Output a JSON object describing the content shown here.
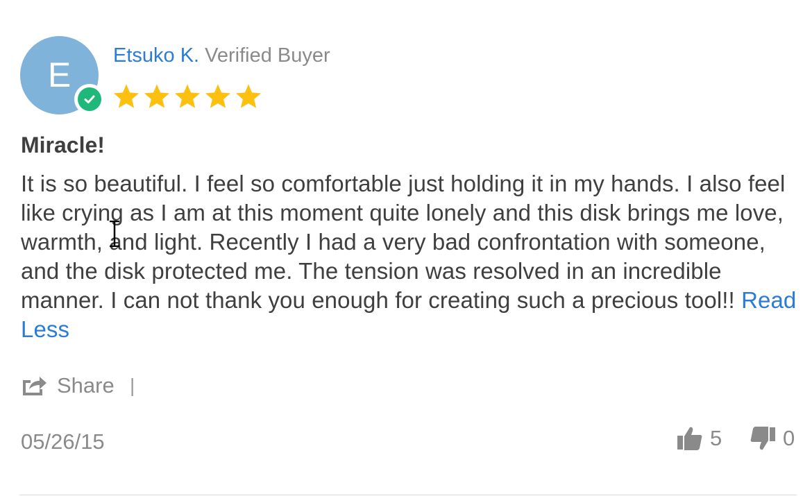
{
  "review": {
    "avatar_initial": "E",
    "author_name": "Etsuko K.",
    "verified_label": "Verified Buyer",
    "rating": 5,
    "rating_max": 5,
    "title": "Miracle!",
    "body": "It is so beautiful. I feel so comfortable just holding it in my hands. I also feel like crying as I am at this moment quite lonely and this disk brings me love, warmth, and light. Recently I had a very bad confrontation with someone, and the disk protected me. The tension was resolved in an incredible manner. I can not thank you enough for creating such a precious tool!!",
    "read_less_label": "Read Less",
    "share_label": "Share",
    "share_separator": "|",
    "date": "05/26/15",
    "upvotes": "5",
    "downvotes": "0"
  },
  "colors": {
    "accent": "#2b7bd9",
    "avatar_bg": "#7fb3da",
    "verified_green": "#1fb77a",
    "star": "#fcc010",
    "muted": "#8a8a8a",
    "text": "#3f3f3f"
  },
  "icons": {
    "verified": "check-circle-icon",
    "star": "star-icon",
    "share": "share-icon",
    "upvote": "thumbs-up-icon",
    "downvote": "thumbs-down-icon"
  }
}
